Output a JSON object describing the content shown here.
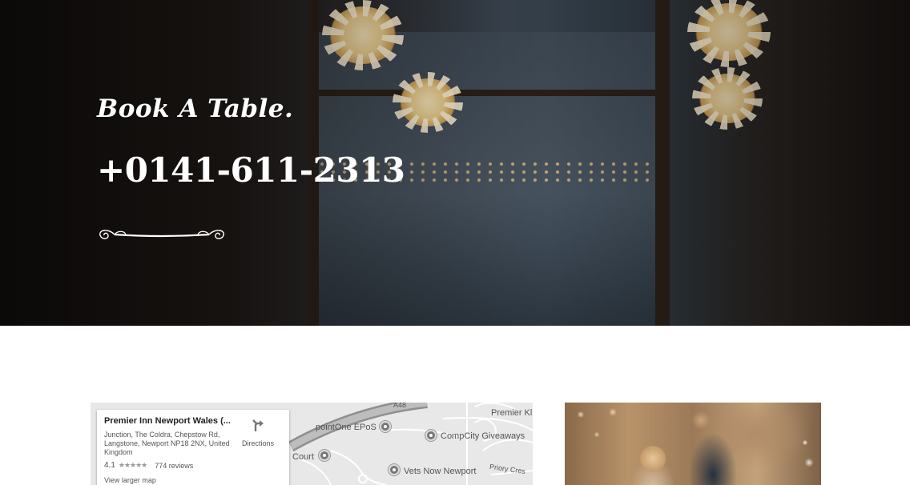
{
  "hero": {
    "title": "Book A Table.",
    "phone": "+0141-611-2313"
  },
  "map": {
    "place_name": "Premier Inn Newport Wales (...",
    "address": "Junction, The Coldra, Chepstow Rd, Langstone, Newport NP18 2NX, United Kingdom",
    "rating": "4.1",
    "stars": "★★★★★",
    "reviews": "774 reviews",
    "directions_label": "Directions",
    "larger_map_label": "View larger map",
    "labels": {
      "premier": "Premier Kl",
      "pointone": "pointOne EPoS",
      "compcity": "CompCity Giveaways",
      "court": "Court",
      "vets": "Vets Now Newport",
      "priory": "Priory Cres",
      "road": "A48"
    }
  },
  "colors": {
    "hero_text": "#ffffff",
    "map_bg": "#e8e8e8",
    "page_bg": "#ffffff"
  },
  "icons": {
    "directions": "directions-icon",
    "ornament": "ornament-divider-icon",
    "pin": "map-pin-icon"
  }
}
